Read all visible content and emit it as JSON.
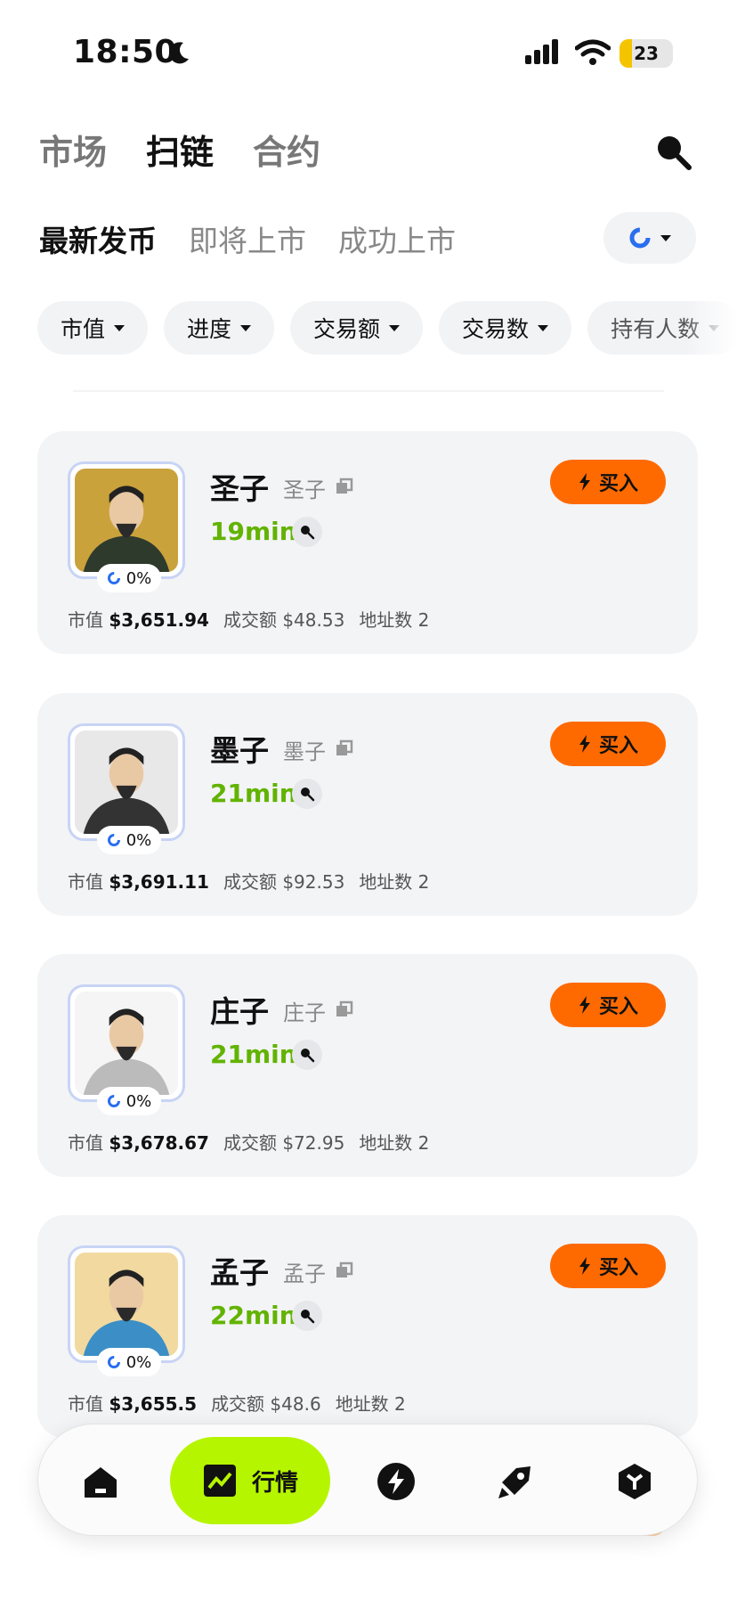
{
  "status_bar": {
    "time": "18:50",
    "battery": "23",
    "battery_level": 0.23
  },
  "top_tabs": [
    {
      "label": "市场",
      "active": false
    },
    {
      "label": "扫链",
      "active": true
    },
    {
      "label": "合约",
      "active": false
    }
  ],
  "sub_tabs": [
    {
      "label": "最新发币",
      "active": true
    },
    {
      "label": "即将上市",
      "active": false
    },
    {
      "label": "成功上市",
      "active": false
    }
  ],
  "filters": [
    {
      "label": "市值"
    },
    {
      "label": "进度"
    },
    {
      "label": "交易额"
    },
    {
      "label": "交易数"
    },
    {
      "label": "持有人数"
    }
  ],
  "tokens": [
    {
      "name": "圣子",
      "symbol": "圣子",
      "age": "19min",
      "progress": "0%",
      "mcap_label": "市值",
      "mcap": "$3,651.94",
      "volume_label": "成交额",
      "volume": "$48.53",
      "holders_label": "地址数",
      "holders": "2",
      "buy_label": "买入",
      "avatar_bg": "#c9a23c",
      "robe": "#2e3a2c"
    },
    {
      "name": "墨子",
      "symbol": "墨子",
      "age": "21min",
      "progress": "0%",
      "mcap_label": "市值",
      "mcap": "$3,691.11",
      "volume_label": "成交额",
      "volume": "$92.53",
      "holders_label": "地址数",
      "holders": "2",
      "buy_label": "买入",
      "avatar_bg": "#e8e8e8",
      "robe": "#333333"
    },
    {
      "name": "庄子",
      "symbol": "庄子",
      "age": "21min",
      "progress": "0%",
      "mcap_label": "市值",
      "mcap": "$3,678.67",
      "volume_label": "成交额",
      "volume": "$72.95",
      "holders_label": "地址数",
      "holders": "2",
      "buy_label": "买入",
      "avatar_bg": "#f5f5f5",
      "robe": "#bbbbbb"
    },
    {
      "name": "孟子",
      "symbol": "孟子",
      "age": "22min",
      "progress": "0%",
      "mcap_label": "市值",
      "mcap": "$3,655.5",
      "volume_label": "成交额",
      "volume": "$48.6",
      "holders_label": "地址数",
      "holders": "2",
      "buy_label": "买入",
      "avatar_bg": "#f1d9a0",
      "robe": "#3b8fc6"
    }
  ],
  "bottom_nav": {
    "items": [
      {
        "icon": "home-icon"
      },
      {
        "icon": "market-chart-icon",
        "label": "行情",
        "active": true
      },
      {
        "icon": "lightning-icon"
      },
      {
        "icon": "rocket-icon"
      },
      {
        "icon": "cube-icon"
      }
    ]
  },
  "colors": {
    "accent_green": "#b6f500",
    "buy_orange": "#ff6a00",
    "age_green": "#62b300"
  }
}
